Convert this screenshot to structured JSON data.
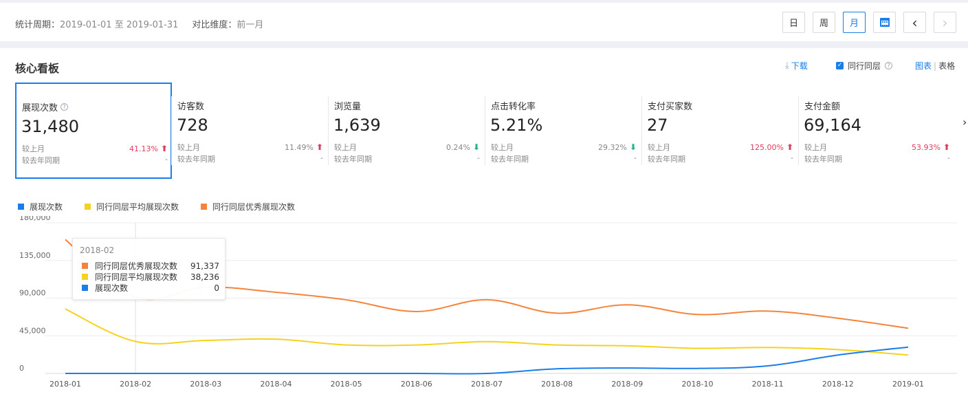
{
  "period": {
    "label": "统计周期：",
    "range": "2019-01-01 至 2019-01-31",
    "compare_label": "对比维度：",
    "compare_value": "前一月"
  },
  "period_buttons": [
    {
      "label": "日",
      "active": false
    },
    {
      "label": "周",
      "active": false
    },
    {
      "label": "月",
      "active": true
    }
  ],
  "icons": {
    "calendar": "calendar-icon",
    "prev": "‹",
    "next": "›",
    "download": "⤓",
    "check": "✓",
    "help": "?"
  },
  "panel": {
    "title": "核心看板",
    "download": "下载",
    "peer": "同行同层",
    "view_chart": "图表",
    "view_sep": "|",
    "view_table": "表格"
  },
  "metrics": [
    {
      "label": "展现次数",
      "value": "31,480",
      "mom_label": "较上月",
      "mom": "41.13%",
      "dir": "up",
      "yoy_label": "较去年同期",
      "yoy": "-",
      "help": true,
      "selected": true
    },
    {
      "label": "访客数",
      "value": "728",
      "mom_label": "较上月",
      "mom": "11.49%",
      "dir": "up",
      "yoy_label": "较去年同期",
      "yoy": "-"
    },
    {
      "label": "浏览量",
      "value": "1,639",
      "mom_label": "较上月",
      "mom": "0.24%",
      "dir": "down",
      "yoy_label": "较去年同期",
      "yoy": "-"
    },
    {
      "label": "点击转化率",
      "value": "5.21%",
      "mom_label": "较上月",
      "mom": "29.32%",
      "dir": "down",
      "yoy_label": "较去年同期",
      "yoy": "-"
    },
    {
      "label": "支付买家数",
      "value": "27",
      "mom_label": "较上月",
      "mom": "125.00%",
      "dir": "up",
      "yoy_label": "较去年同期",
      "yoy": "-"
    },
    {
      "label": "支付金额",
      "value": "69,164",
      "mom_label": "较上月",
      "mom": "53.93%",
      "dir": "up",
      "yoy_label": "较去年同期",
      "yoy": "-"
    }
  ],
  "more_arrow": "›",
  "colors": {
    "blue": "#1a7de8",
    "yellow": "#f5d21e",
    "orange": "#f5843a",
    "up": "#e03b5c",
    "down": "#26b08b"
  },
  "chart_data": {
    "type": "line",
    "x": [
      "2018-01",
      "2018-02",
      "2018-03",
      "2018-04",
      "2018-05",
      "2018-06",
      "2018-07",
      "2018-08",
      "2018-09",
      "2018-10",
      "2018-11",
      "2018-12",
      "2019-01"
    ],
    "series": [
      {
        "name": "展现次数",
        "color": "#1a7de8",
        "values": [
          0,
          0,
          0,
          0,
          0,
          0,
          0,
          5500,
          6500,
          6000,
          9000,
          22000,
          31480
        ]
      },
      {
        "name": "同行同层平均展现次数",
        "color": "#f5d21e",
        "values": [
          77000,
          38236,
          39500,
          41000,
          34000,
          34000,
          38000,
          34000,
          33000,
          30000,
          31000,
          28500,
          22000
        ]
      },
      {
        "name": "同行同层优秀展现次数",
        "color": "#f5843a",
        "values": [
          160000,
          91337,
          103000,
          97000,
          88000,
          74000,
          88000,
          72000,
          82000,
          70500,
          74500,
          66000,
          54000
        ]
      }
    ],
    "ylim": [
      0,
      180000
    ],
    "yticks": [
      "0",
      "45,000",
      "90,000",
      "135,000",
      "180,000"
    ],
    "grid": true,
    "legend": "top-left",
    "tooltip": {
      "title": "2018-02",
      "rows": [
        {
          "name": "同行同层优秀展现次数",
          "value": "91,337",
          "color": "#f5843a"
        },
        {
          "name": "同行同层平均展现次数",
          "value": "38,236",
          "color": "#f5d21e"
        },
        {
          "name": "展现次数",
          "value": "0",
          "color": "#1a7de8"
        }
      ]
    }
  }
}
